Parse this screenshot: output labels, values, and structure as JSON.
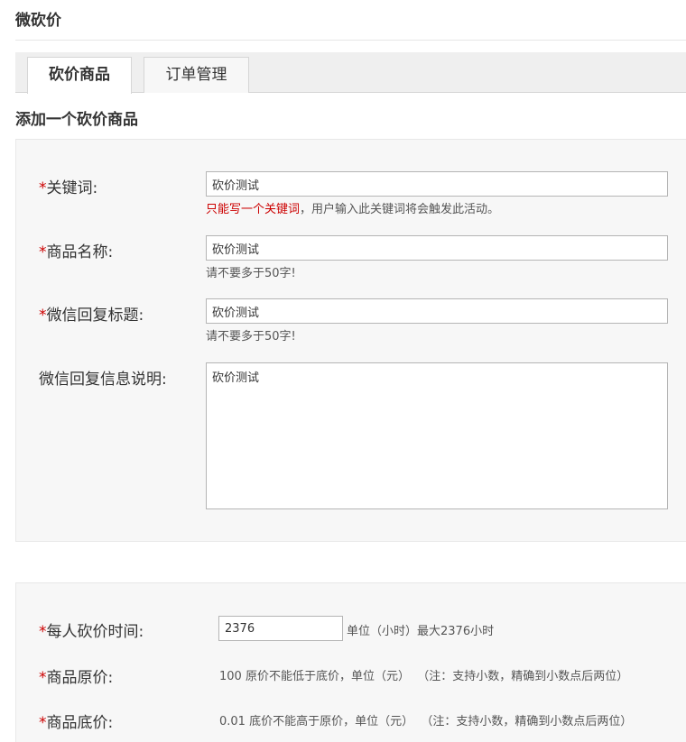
{
  "header": {
    "title": "微砍价"
  },
  "tabs": [
    {
      "label": "砍价商品",
      "active": true
    },
    {
      "label": "订单管理",
      "active": false
    }
  ],
  "section": {
    "title": "添加一个砍价商品"
  },
  "form": {
    "required_mark": "*",
    "keyword": {
      "label": "关键词:",
      "value": "砍价测试",
      "hint_warn": "只能写一个关键词",
      "hint_rest": "，用户输入此关键词将会触发此活动。"
    },
    "product_name": {
      "label": "商品名称:",
      "value": "砍价测试",
      "hint": "请不要多于50字!"
    },
    "reply_title": {
      "label": "微信回复标题:",
      "value": "砍价测试",
      "hint": "请不要多于50字!"
    },
    "reply_desc": {
      "label": "微信回复信息说明:",
      "value": "砍价测试"
    },
    "time_per_person": {
      "label": "每人砍价时间:",
      "value": "2376",
      "unit_text": "单位（小时）最大2376小时"
    },
    "original_price": {
      "label": "商品原价:",
      "value": "100",
      "text": "原价不能低于底价，单位（元）",
      "note": "（注：支持小数，精确到小数点后两位）"
    },
    "floor_price": {
      "label": "商品底价:",
      "value": "0.01",
      "text": "底价不能高于原价，单位（元）",
      "note": "（注：支持小数，精确到小数点后两位）"
    }
  },
  "colors": {
    "required": "#cc0000",
    "panel_bg": "#f7f7f7",
    "tabbar_bg": "#efefef"
  }
}
